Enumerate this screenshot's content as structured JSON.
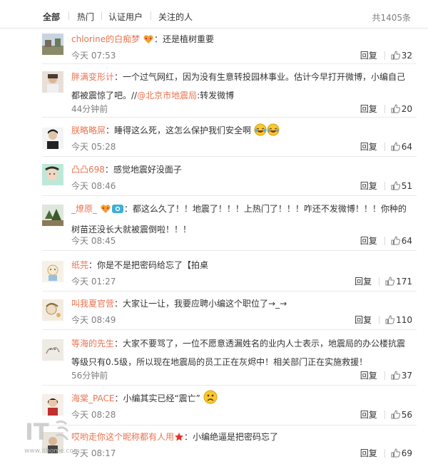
{
  "tabs": [
    {
      "label": "全部"
    },
    {
      "label": "热门"
    },
    {
      "label": "认证用户"
    },
    {
      "label": "关注的人"
    }
  ],
  "total": "共1405条",
  "reply_label": "回复",
  "comments": [
    {
      "user": "chlorine的白痴梦",
      "text": "：还是植树重要",
      "time": "今天 07:53",
      "likes": "32"
    },
    {
      "user": "胖满变形计",
      "text": "：一个过气网红，因为没有生意转投园林事业。估计今早打开微博，小编自己都被震惊了吧。//",
      "mention": "@北京市地震局",
      "text2": ":转发微博",
      "time": "44分钟前",
      "likes": "20"
    },
    {
      "user": "朕略略屌",
      "text": "：睡得这么死，这怎么保护我们安全啊",
      "time": "今天 05:28",
      "likes": "64"
    },
    {
      "user": "凸凸698",
      "text": "：感觉地震好没面子",
      "time": "今天 08:46",
      "likes": "51"
    },
    {
      "user": "_燎原_",
      "text": "：都这么久了！！地震了！！！上热门了！！！咋还不发微博！！！你种的树苗还没长大就被震倒啦！！！",
      "time": "今天 08:45",
      "likes": "64"
    },
    {
      "user": "纸芫",
      "text": "：你是不是把密码给忘了【拍桌",
      "time": "今天 01:27",
      "likes": "171"
    },
    {
      "user": "叫我夏官营",
      "text": "：大家让一让，我要应聘小编这个职位了→_→",
      "time": "今天 08:49",
      "likes": "110"
    },
    {
      "user": "等海的先生",
      "text": "：大家不要骂了，一位不愿意透漏姓名的业内人士表示，地震局的办公楼抗震等级只有0.5级，所以现在地震局的员工正在灰烬中！相关部门正在实施救援！",
      "time": "56分钟前",
      "likes": "37"
    },
    {
      "user": "海棠_PACE",
      "text": "：小编其实已经“震亡”",
      "time": "今天 08:28",
      "likes": "56"
    },
    {
      "user": "哎哟走你这个昵称都有人用",
      "text": "：小编绝逼是把密码忘了",
      "time": "今天 08:17",
      "likes": "69"
    }
  ],
  "watermark_url": "www.ithome.com",
  "colors": {
    "username": "#eb7350",
    "meta": "#808080",
    "text": "#333333"
  }
}
